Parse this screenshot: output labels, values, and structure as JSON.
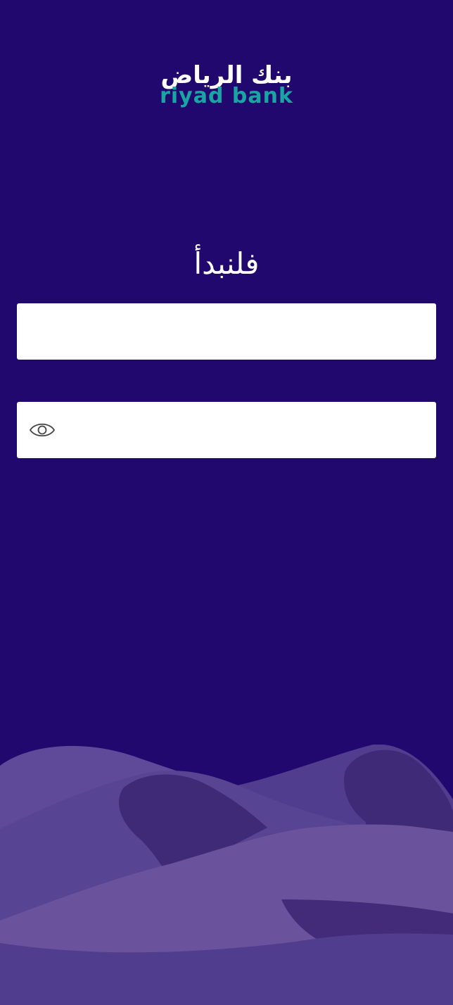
{
  "logo": {
    "arabic": "بنك الرياض",
    "english": "riyad bank"
  },
  "heading": "فلنبدأ",
  "username_field": {
    "value": "",
    "placeholder": ""
  },
  "password_field": {
    "value": "",
    "placeholder": "",
    "toggle_icon": "eye-icon"
  },
  "colors": {
    "background": "#21086e",
    "logo_accent": "#19a6a2",
    "dune_light": "#6a539c",
    "dune_mid": "#574493",
    "dune_dark": "#402a78"
  }
}
